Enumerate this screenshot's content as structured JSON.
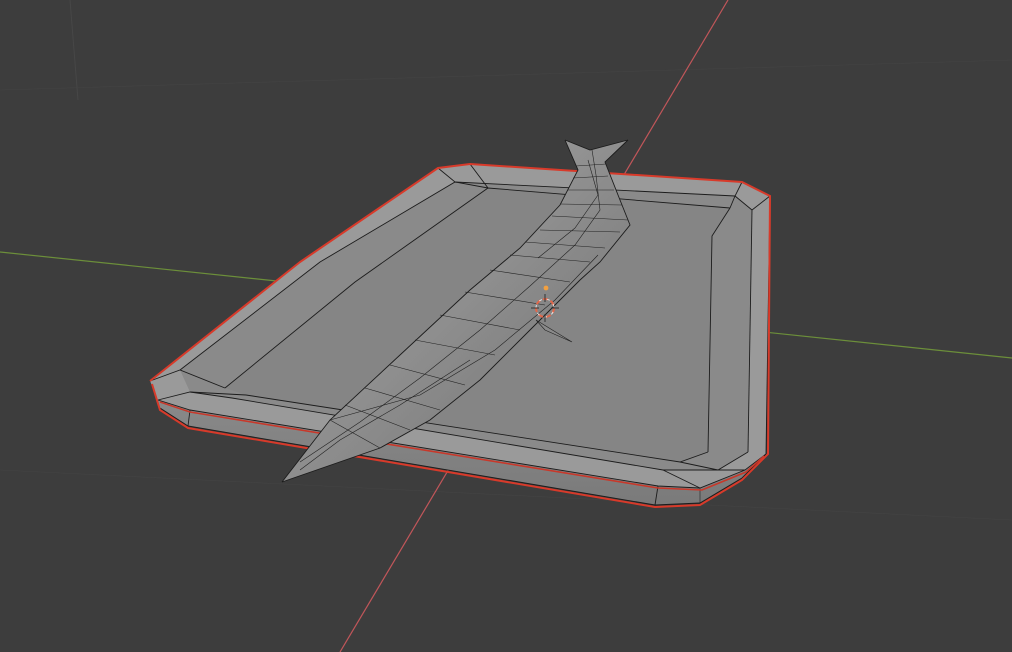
{
  "viewport": {
    "shading": "solid",
    "overlay": "wireframe",
    "background_color": "#3d3d3d",
    "grid_color": "#474747"
  },
  "axes": {
    "x_axis_color": "#c1565a",
    "y_axis_color": "#6c8f3a"
  },
  "scene": {
    "objects": [
      {
        "id": "tray",
        "kind": "mesh",
        "selected": true,
        "outline_color": "#d83a2a",
        "surface_color": "#8f8f8f"
      },
      {
        "id": "fish",
        "kind": "mesh",
        "selected": false,
        "surface_color": "#9a9a9a"
      }
    ],
    "cursor": {
      "kind": "3d-cursor",
      "color": "#e2674a",
      "icon": "crosshair-circle-icon"
    },
    "origin": {
      "color": "#f2a040",
      "icon": "origin-dot-icon"
    }
  }
}
